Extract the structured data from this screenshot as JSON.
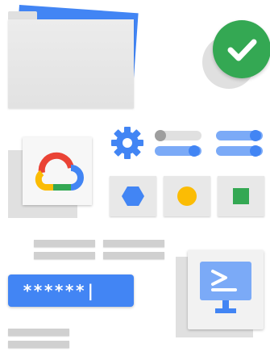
{
  "illustration": {
    "password_field": {
      "value": "******|"
    },
    "colors": {
      "blue": "#4285f4",
      "light_blue": "#7baaf7",
      "green": "#34a853",
      "yellow": "#fbbc04",
      "red": "#ea4335",
      "gray": "#e0e0e0",
      "dark_gray": "#9e9e9e"
    },
    "toggles": [
      {
        "state": "off"
      },
      {
        "state": "on"
      },
      {
        "state": "on"
      },
      {
        "state": "on"
      }
    ],
    "shape_tiles": [
      "hexagon",
      "circle",
      "square"
    ],
    "icons": [
      "folder-icon",
      "checkmark-icon",
      "google-cloud-logo",
      "gear-icon",
      "terminal-monitor-icon"
    ]
  }
}
